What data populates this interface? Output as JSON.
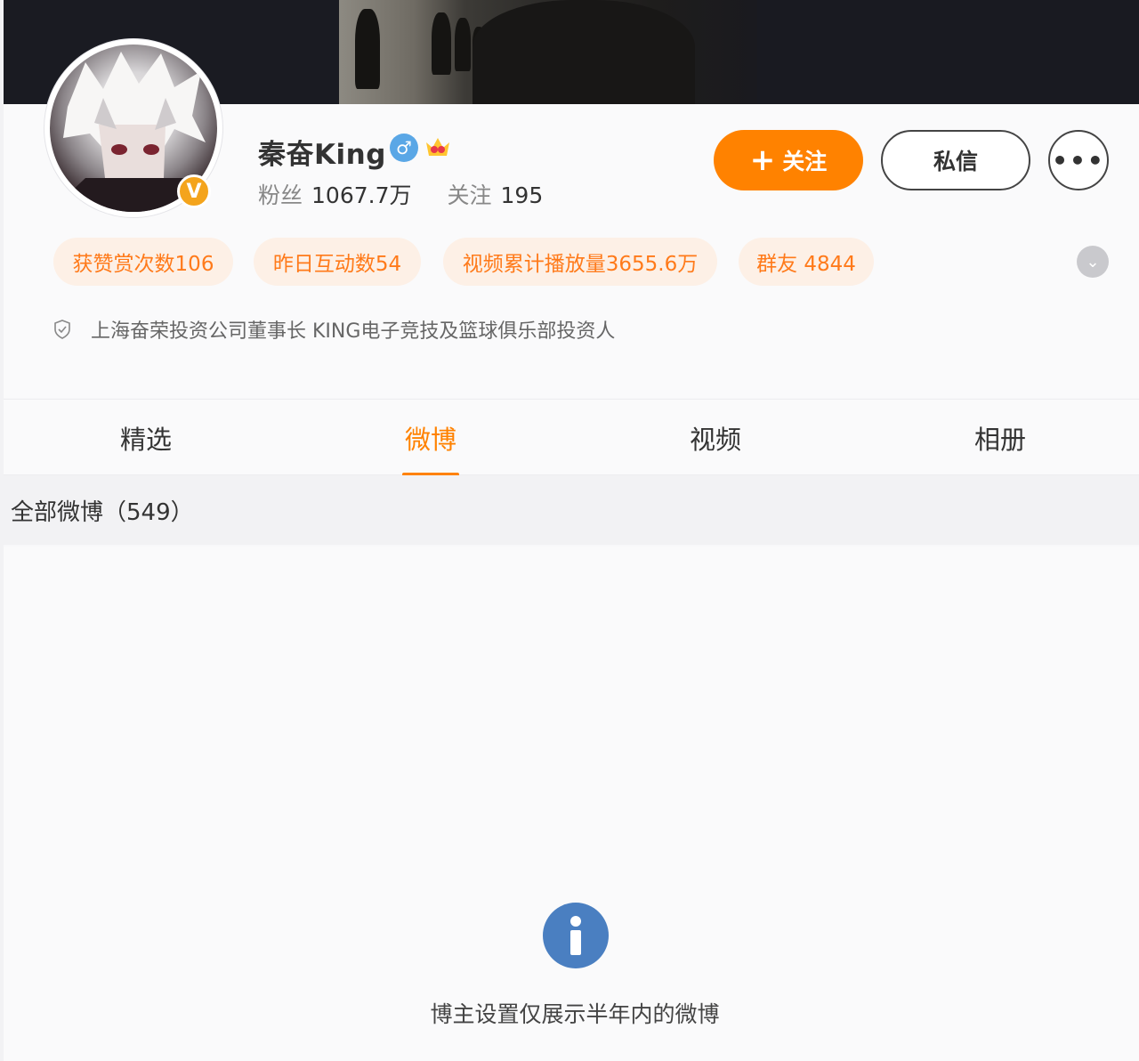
{
  "profile": {
    "name": "秦奋King",
    "gender_icon": "♂",
    "verified_badge": "V",
    "followers_label": "粉丝",
    "followers_value": "1067.7万",
    "following_label": "关注",
    "following_value": "195",
    "bio": "上海奋荣投资公司董事长 KING电子竞技及篮球俱乐部投资人"
  },
  "actions": {
    "follow_plus": "+",
    "follow_label": "关注",
    "message_label": "私信",
    "more_label": "•••"
  },
  "pills": [
    "获赞赏次数106",
    "昨日互动数54",
    "视频累计播放量3655.6万",
    "群友 4844"
  ],
  "expand_icon": "⌄",
  "tabs": [
    {
      "label": "精选"
    },
    {
      "label": "微博"
    },
    {
      "label": "视频"
    },
    {
      "label": "相册"
    }
  ],
  "active_tab": "微博",
  "weibo_count": "全部微博（549）",
  "notice": "博主设置仅展示半年内的微博",
  "info_icon_glyph": "i",
  "colors": {
    "accent": "#ff8200",
    "pill_bg": "#fdf0e6",
    "pill_text": "#ff7a1a",
    "info_blue": "#4a7fc1",
    "verified_gold": "#f4a41c",
    "gender_blue": "#5aa7e6"
  }
}
